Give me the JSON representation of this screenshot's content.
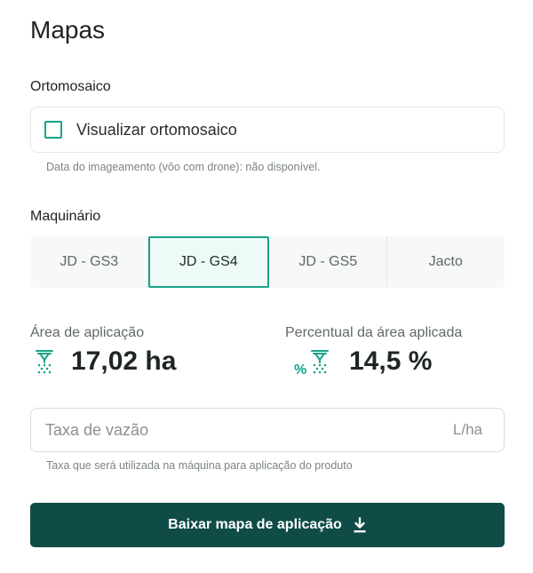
{
  "title": "Mapas",
  "ortomosaico": {
    "section_label": "Ortomosaico",
    "checkbox_label": "Visualizar ortomosaico",
    "checked": false,
    "helper_text": "Data do imageamento (vôo com drone): não disponível."
  },
  "maquinario": {
    "section_label": "Maquinário",
    "tabs": [
      {
        "label": "JD - GS3",
        "active": false
      },
      {
        "label": "JD - GS4",
        "active": true
      },
      {
        "label": "JD - GS5",
        "active": false
      },
      {
        "label": "Jacto",
        "active": false
      }
    ]
  },
  "stats": {
    "area": {
      "label": "Área de aplicação",
      "value": "17,02 ha",
      "icon": "sprayer-icon"
    },
    "percent": {
      "label": "Percentual da área aplicada",
      "value": "14,5 %",
      "icon": "percent-sprayer-icon"
    }
  },
  "rate": {
    "placeholder": "Taxa de vazão",
    "value": "",
    "unit": "L/ha",
    "helper_text": "Taxa que será utilizada na máquina para aplicação do produto"
  },
  "download": {
    "label": "Baixar mapa de aplicação",
    "icon": "download-icon"
  },
  "colors": {
    "accent": "#1aa38a",
    "button_bg": "#0f4c47",
    "active_tab_bg": "#eefaf7"
  }
}
